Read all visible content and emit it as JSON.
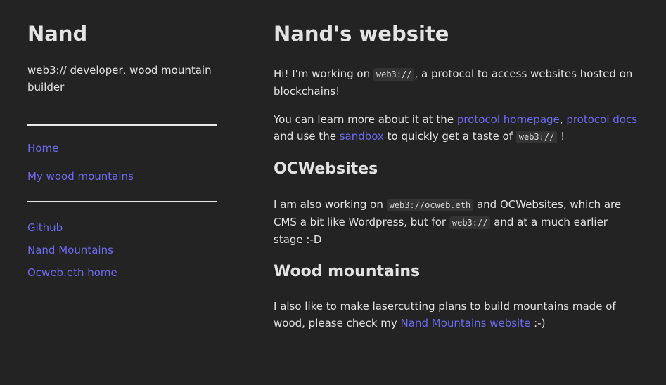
{
  "sidebar": {
    "title": "Nand",
    "tagline": "web3:// developer, wood mountain builder",
    "nav_primary": [
      {
        "label": "Home"
      },
      {
        "label": "My wood mountains"
      }
    ],
    "nav_secondary": [
      {
        "label": "Github"
      },
      {
        "label": "Nand Mountains"
      },
      {
        "label": "Ocweb.eth home"
      }
    ]
  },
  "main": {
    "title": "Nand's website",
    "intro": {
      "before": "Hi! I'm working on ",
      "code": "web3://",
      "after": ", a protocol to access websites hosted on blockchains!"
    },
    "learn_more": {
      "before": "You can learn more about it at the ",
      "link1": "protocol homepage",
      "sep": ", ",
      "link2": "protocol docs",
      "middle": " and use the ",
      "link3": "sandbox",
      "middle2": " to quickly get a taste of ",
      "code": "web3://",
      "after": " !"
    },
    "section_ocwebsites": {
      "heading": "OCWebsites",
      "before": "I am also working on ",
      "code1": "web3://ocweb.eth",
      "middle": " and OCWebsites, which are CMS a bit like Wordpress, but for ",
      "code2": "web3://",
      "after": " and at a much earlier stage :-D"
    },
    "section_wood": {
      "heading": "Wood mountains",
      "before": "I also like to make lasercutting plans to build mountains made of wood, please check my ",
      "link": "Nand Mountains website",
      "after": " :-)"
    }
  },
  "colors": {
    "background": "#232323",
    "text": "#e3e3e3",
    "link": "#6b6bf0",
    "code_bg": "#333333"
  }
}
